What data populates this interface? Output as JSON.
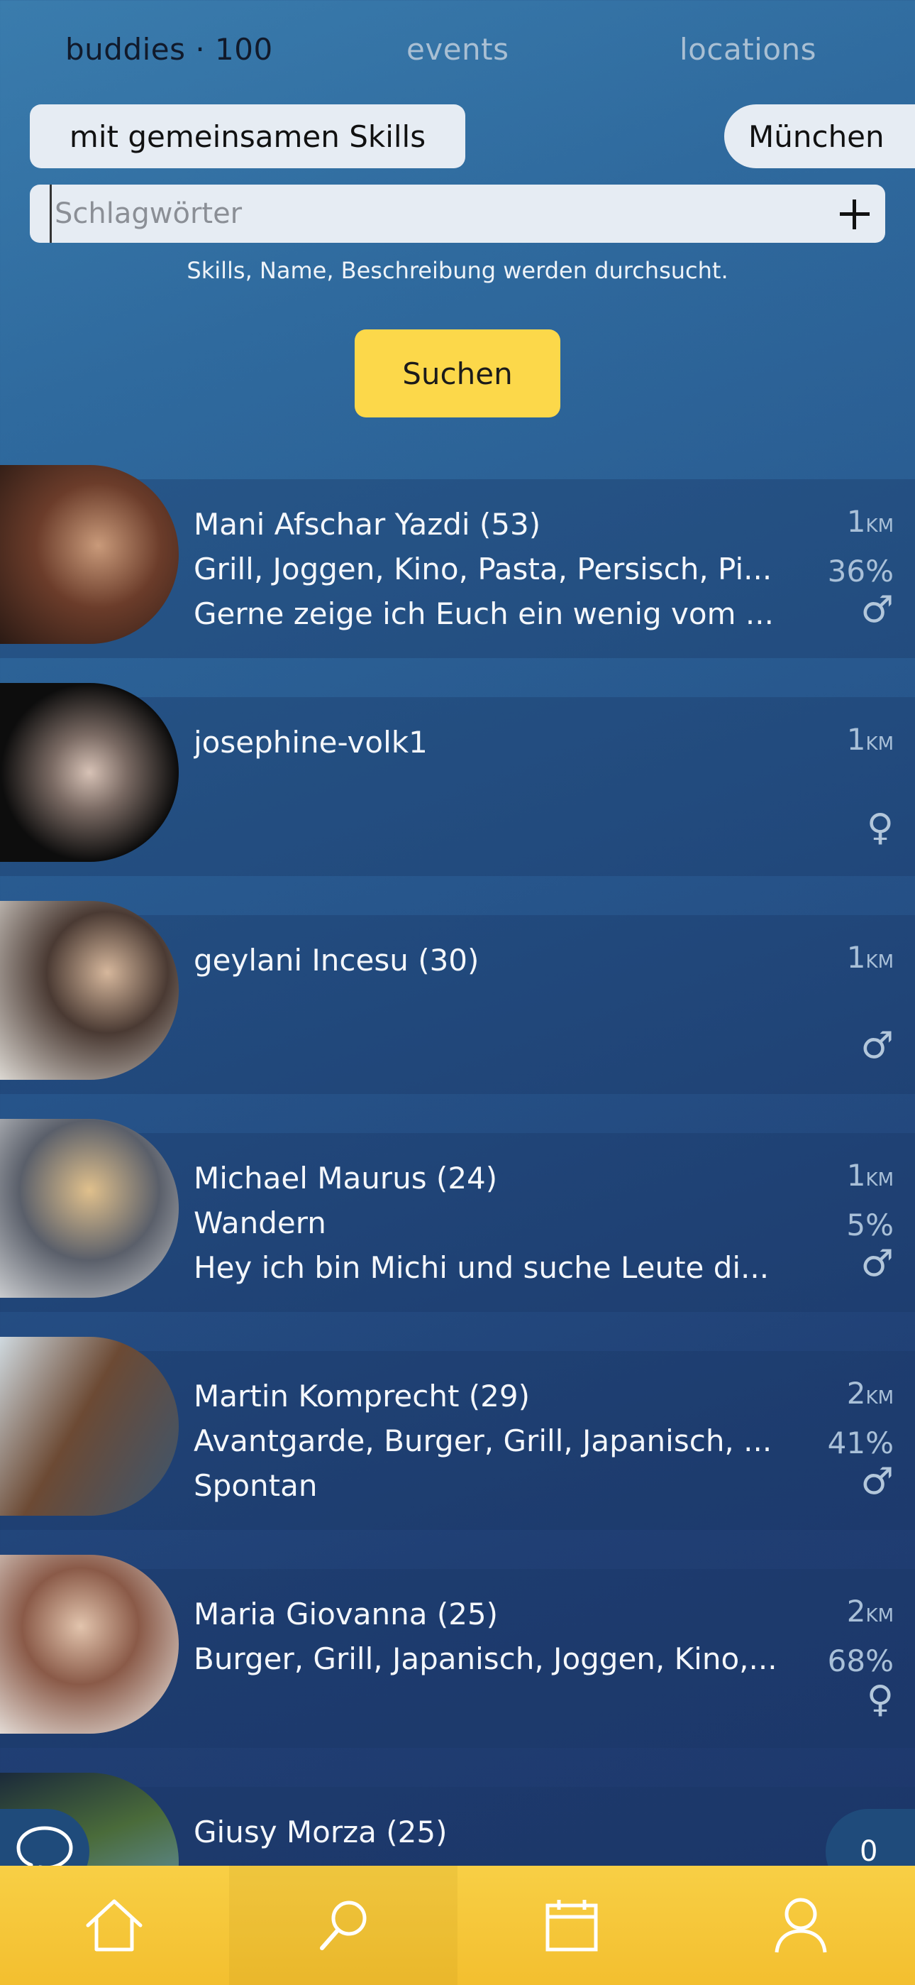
{
  "tabs": {
    "buddies": "buddies · 100",
    "events": "events",
    "locations": "locations"
  },
  "filters": {
    "skills_label": "mit gemeinsamen Skills",
    "city_label": "München"
  },
  "search": {
    "placeholder": "Schlagwörter",
    "value": "",
    "hint": "Skills, Name, Beschreibung werden durchsucht.",
    "submit_label": "Suchen"
  },
  "buddies": [
    {
      "name": "Mani Afschar Yazdi (53)",
      "skills": "Grill, Joggen, Kino, Pasta, Persisch, Pi...",
      "description": "Gerne zeige ich Euch ein wenig vom ...",
      "distance": "1",
      "unit": "KM",
      "match": "36%",
      "gender": "male"
    },
    {
      "name": "josephine-volk1",
      "skills": "",
      "description": "",
      "distance": "1",
      "unit": "KM",
      "match": "",
      "gender": "female"
    },
    {
      "name": "geylani Incesu (30)",
      "skills": "",
      "description": "",
      "distance": "1",
      "unit": "KM",
      "match": "",
      "gender": "male"
    },
    {
      "name": "Michael Maurus (24)",
      "skills": "Wandern",
      "description": "Hey ich bin Michi und suche Leute di...",
      "distance": "1",
      "unit": "KM",
      "match": "5%",
      "gender": "male"
    },
    {
      "name": "Martin Komprecht (29)",
      "skills": "Avantgarde, Burger, Grill, Japanisch, ...",
      "description": "Spontan",
      "distance": "2",
      "unit": "KM",
      "match": "41%",
      "gender": "male"
    },
    {
      "name": "Maria Giovanna (25)",
      "skills": "Burger, Grill, Japanisch, Joggen, Kino,...",
      "description": "",
      "distance": "2",
      "unit": "KM",
      "match": "68%",
      "gender": "female"
    },
    {
      "name": "Giusy Morza (25)",
      "skills": "",
      "description": "",
      "distance": "",
      "unit": "",
      "match": "",
      "gender": ""
    }
  ],
  "gender_symbols": {
    "male": "♂",
    "female": "♀"
  },
  "fab": {
    "chat_icon": "chat-bubble-icon",
    "count": "0"
  },
  "bottom_nav": [
    {
      "icon": "home-icon",
      "active": false
    },
    {
      "icon": "search-icon",
      "active": true
    },
    {
      "icon": "calendar-icon",
      "active": false
    },
    {
      "icon": "profile-icon",
      "active": false
    }
  ],
  "colors": {
    "accent": "#fcd84a",
    "nav": "#f5c83a",
    "fab": "#1f4b7b"
  }
}
